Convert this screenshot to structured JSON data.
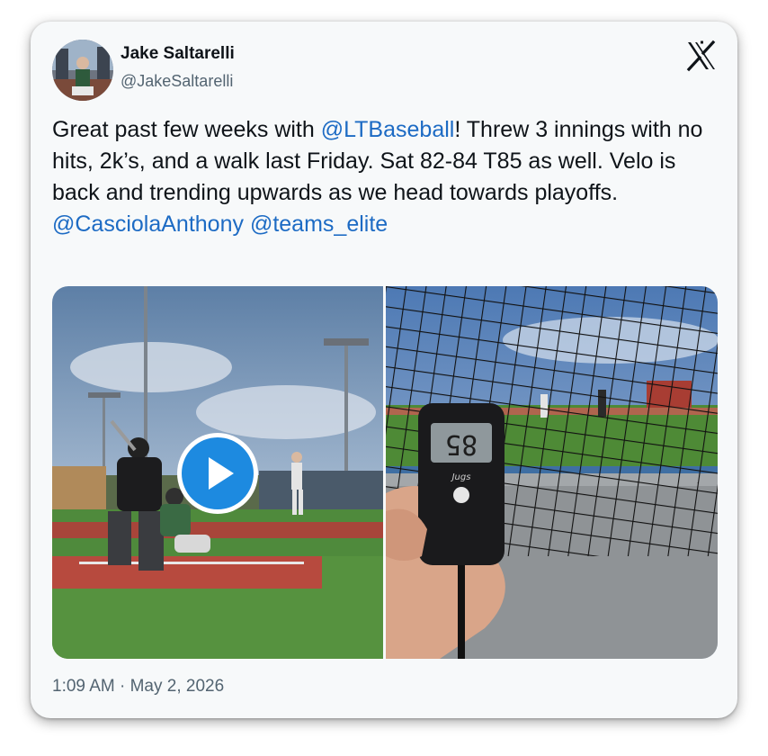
{
  "author": {
    "name": "Jake Saltarelli",
    "handle": "@JakeSaltarelli"
  },
  "tweet": {
    "segments": [
      {
        "text": "Great past few weeks with ",
        "mention": false
      },
      {
        "text": "@LTBaseball",
        "mention": true
      },
      {
        "text": "! Threw 3 innings with no hits, 2k’s, and a walk last Friday. Sat 82-84 T85 as well. Velo is back and trending upwards as we head towards playoffs.",
        "mention": false
      }
    ],
    "mentions_line": [
      "@CasciolaAnthony",
      "@teams_elite"
    ]
  },
  "media": {
    "radar_display": "85",
    "radar_brand": "Jugs"
  },
  "timestamp": "1:09 AM · May 2, 2026",
  "colors": {
    "mention": "#1d6bc4",
    "text": "#0f1419",
    "secondary": "#536471",
    "play_button": "#1d8ae0"
  }
}
